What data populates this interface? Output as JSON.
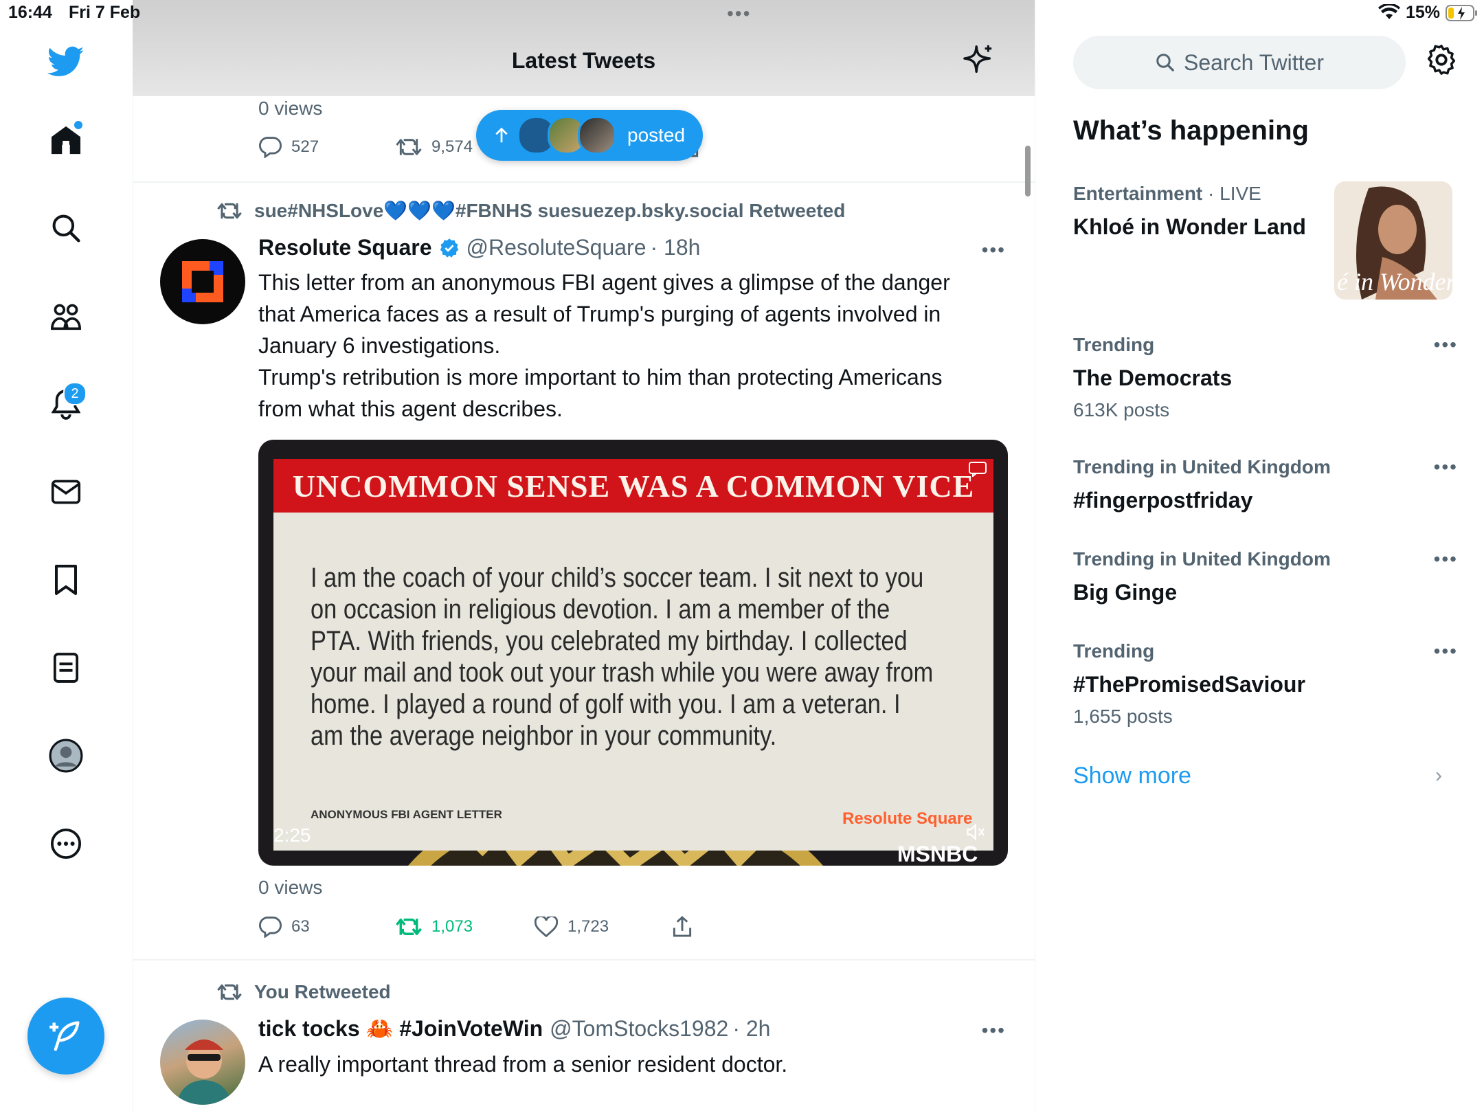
{
  "status_bar": {
    "time": "16:44",
    "date": "Fri 7 Feb",
    "battery": "15%"
  },
  "nav": {
    "notification_count": "2"
  },
  "main": {
    "title": "Latest Tweets",
    "prev_tweet": {
      "views": "0 views",
      "replies": "527",
      "retweets": "9,574"
    },
    "new_posts_pill": {
      "label": "posted"
    },
    "tweets": [
      {
        "retweeted_by": "sue#NHSLove💙💙💙#FBNHS suesuezep.bsky.social Retweeted",
        "name": "Resolute Square",
        "handle": "@ResoluteSquare",
        "time": "· 18h",
        "text_lines": [
          "This letter from an anonymous FBI agent gives a glimpse of the danger",
          "that America faces as a result of Trump's purging of agents involved in",
          "January 6 investigations.",
          "Trump's retribution is more important to him than protecting Americans",
          "from what this agent describes."
        ],
        "media": {
          "headline": "UNCOMMON SENSE WAS A COMMON VICE",
          "letter_lines": [
            "I am the coach of your child’s soccer team. I sit next to you",
            "on occasion in religious devotion. I am a member of the",
            "PTA. With friends, you celebrated my birthday. I collected",
            "your mail and took out your trash while you were away from",
            "home. I played a round of golf with you. I am a veteran. I",
            "am the average neighbor in your community."
          ],
          "source": "ANONYMOUS FBI AGENT LETTER",
          "duration": "2:25",
          "brand": "Resolute Square",
          "network": "MSNBC"
        },
        "views": "0 views",
        "replies": "63",
        "retweets": "1,073",
        "likes": "1,723"
      },
      {
        "retweeted_by": "You Retweeted",
        "name": "tick tocks 🦀 #JoinVoteWin",
        "handle": "@TomStocks1982",
        "time": "· 2h",
        "text": "A really important thread from a senior resident doctor."
      }
    ]
  },
  "sidebar": {
    "search_placeholder": "Search Twitter",
    "whats_happening": "What’s happening",
    "trends": [
      {
        "context": "Entertainment",
        "context_extra": "· LIVE",
        "name": "Khloé in Wonder Land",
        "count": ""
      },
      {
        "context": "Trending",
        "name": "The Democrats",
        "count": "613K posts"
      },
      {
        "context": "Trending in United Kingdom",
        "name": "#fingerpostfriday",
        "count": ""
      },
      {
        "context": "Trending in United Kingdom",
        "name": "Big Ginge",
        "count": ""
      },
      {
        "context": "Trending",
        "name": "#ThePromisedSaviour",
        "count": "1,655 posts"
      }
    ],
    "show_more": "Show more"
  },
  "colors": {
    "accent": "#1d9bf0",
    "retweet_green": "#00ba7c",
    "secondary_text": "#536471"
  }
}
